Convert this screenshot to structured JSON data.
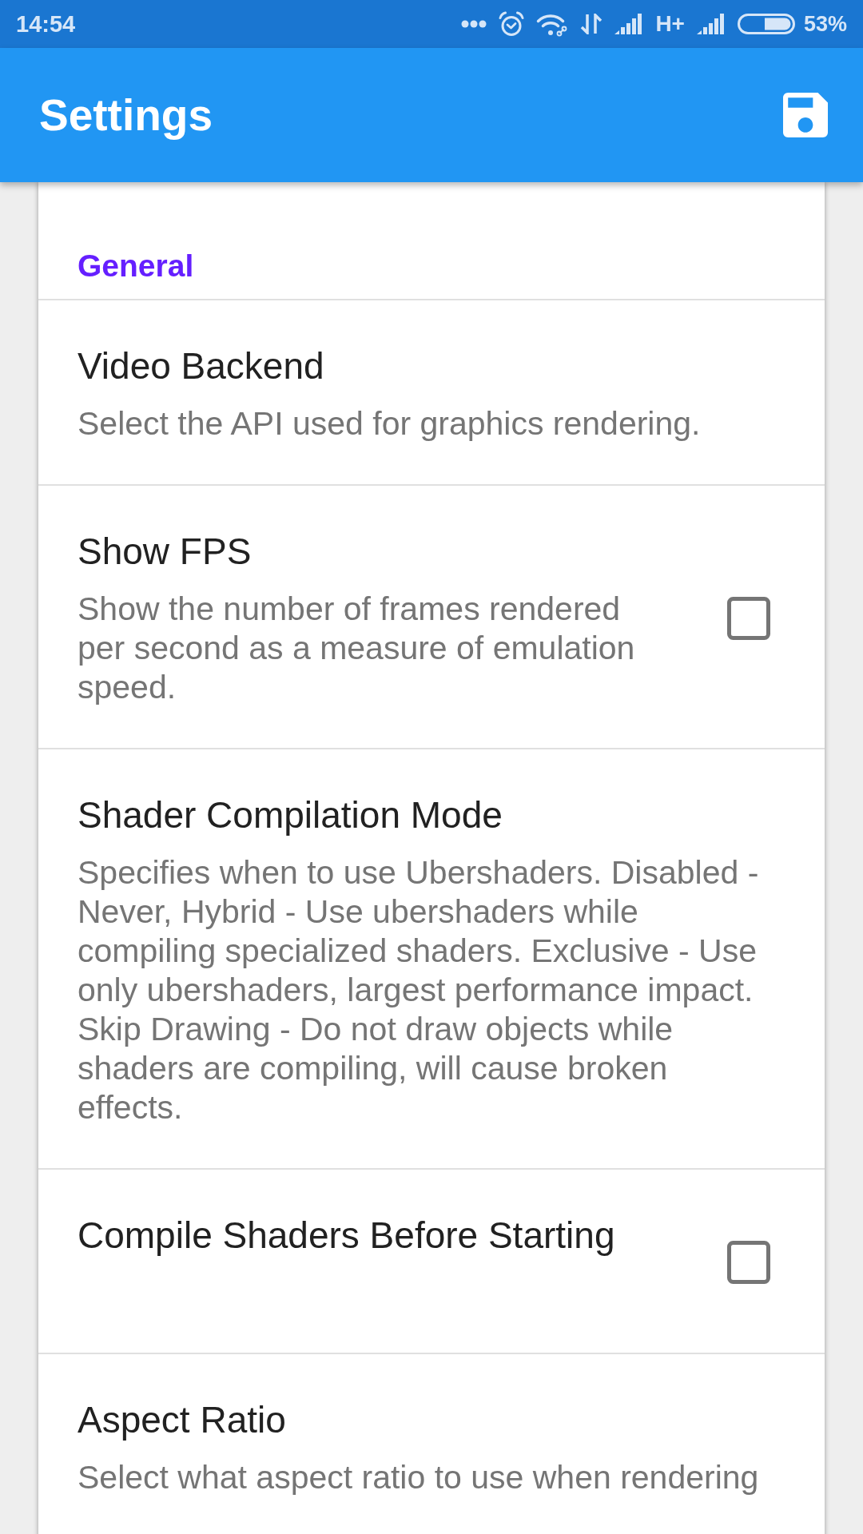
{
  "status_bar": {
    "time": "14:54",
    "network_type": "H+",
    "battery": "53%"
  },
  "app_bar": {
    "title": "Settings"
  },
  "sections": [
    {
      "header": "General",
      "items": [
        {
          "kind": "list",
          "title": "Video Backend",
          "summary": "Select the API used for graphics rendering."
        },
        {
          "kind": "checkbox",
          "title": "Show FPS",
          "summary": "Show the number of frames rendered per second as a measure of emulation speed.",
          "checked": false
        },
        {
          "kind": "list",
          "title": "Shader Compilation Mode",
          "summary": "Specifies when to use Ubershaders. Disabled - Never, Hybrid - Use ubershaders while compiling specialized shaders. Exclusive - Use only ubershaders, largest performance impact. Skip Drawing - Do not draw objects while shaders are compiling, will cause broken effects."
        },
        {
          "kind": "checkbox",
          "title": "Compile Shaders Before Starting",
          "checked": false
        },
        {
          "kind": "list",
          "title": "Aspect Ratio",
          "summary": "Select what aspect ratio to use when rendering"
        }
      ]
    }
  ]
}
